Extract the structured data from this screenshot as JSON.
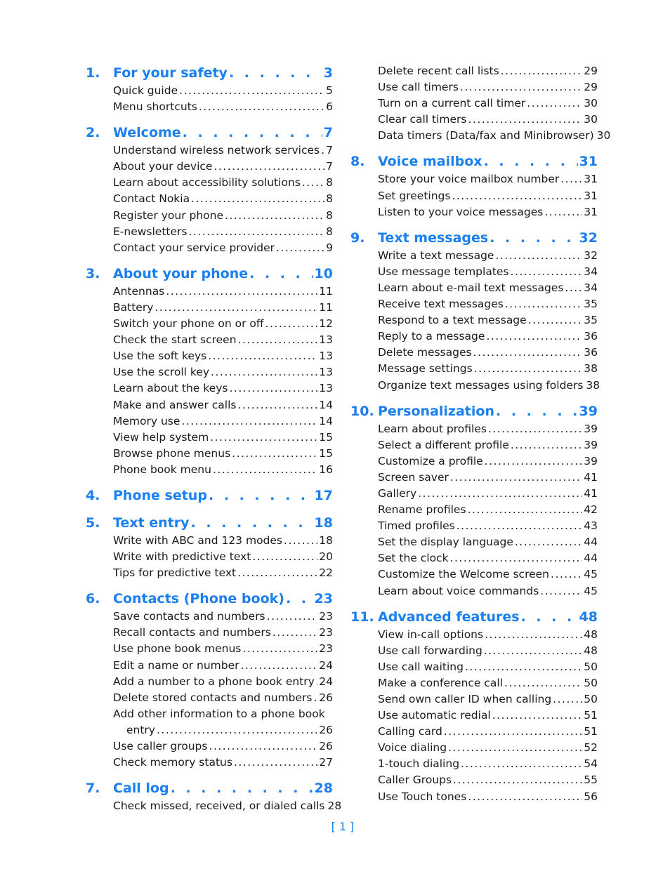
{
  "accent_color": "#1a7ff0",
  "left_column": [
    {
      "num": "1.",
      "title": "For your safety",
      "page": "3",
      "entries": [
        {
          "title": "Quick guide",
          "page": "5"
        },
        {
          "title": "Menu shortcuts",
          "page": "6"
        }
      ]
    },
    {
      "num": "2.",
      "title": "Welcome",
      "page": "7",
      "entries": [
        {
          "title": "Understand wireless network services",
          "page": "7"
        },
        {
          "title": "About your device",
          "page": "7"
        },
        {
          "title": "Learn about accessibility solutions",
          "page": "8"
        },
        {
          "title": "Contact Nokia",
          "page": "8"
        },
        {
          "title": "Register your phone",
          "page": "8"
        },
        {
          "title": "E-newsletters",
          "page": "8"
        },
        {
          "title": "Contact your service provider",
          "page": "9"
        }
      ]
    },
    {
      "num": "3.",
      "title": "About your phone",
      "page": "10",
      "entries": [
        {
          "title": "Antennas",
          "page": "11"
        },
        {
          "title": "Battery",
          "page": "11"
        },
        {
          "title": "Switch your phone on or off",
          "page": "12"
        },
        {
          "title": "Check the start screen",
          "page": "13"
        },
        {
          "title": "Use the soft keys",
          "page": "13"
        },
        {
          "title": "Use the scroll key",
          "page": "13"
        },
        {
          "title": "Learn about the keys",
          "page": "13"
        },
        {
          "title": "Make and answer calls",
          "page": "14"
        },
        {
          "title": "Memory use",
          "page": "14"
        },
        {
          "title": "View help system",
          "page": "15"
        },
        {
          "title": "Browse phone menus",
          "page": "15"
        },
        {
          "title": "Phone book menu",
          "page": "16"
        }
      ]
    },
    {
      "num": "4.",
      "title": "Phone setup",
      "page": "17",
      "entries": []
    },
    {
      "num": "5.",
      "title": "Text entry",
      "page": "18",
      "entries": [
        {
          "title": "Write with ABC and 123 modes",
          "page": "18"
        },
        {
          "title": "Write with predictive text",
          "page": "20"
        },
        {
          "title": "Tips for predictive text",
          "page": "22"
        }
      ]
    },
    {
      "num": "6.",
      "title": "Contacts (Phone book)",
      "page": "23",
      "entries": [
        {
          "title": "Save contacts and numbers",
          "page": "23"
        },
        {
          "title": "Recall contacts and numbers",
          "page": "23"
        },
        {
          "title": "Use phone book menus",
          "page": "23"
        },
        {
          "title": "Edit a name or number",
          "page": "24"
        },
        {
          "title": "Add a number to a phone book entry",
          "page": "24"
        },
        {
          "title": "Delete stored contacts and numbers",
          "page": "26"
        },
        {
          "title": "Add other information to a phone book",
          "continuation": "entry",
          "page": "26"
        },
        {
          "title": "Use caller groups",
          "page": "26"
        },
        {
          "title": "Check memory status",
          "page": "27"
        }
      ]
    },
    {
      "num": "7.",
      "title": "Call log",
      "page": "28",
      "entries": [
        {
          "title": "Check missed, received, or dialed calls",
          "page": "28"
        }
      ]
    }
  ],
  "right_column": [
    {
      "num": "",
      "title": "",
      "page": "",
      "entries": [
        {
          "title": "Delete recent call lists",
          "page": "29"
        },
        {
          "title": "Use call timers",
          "page": "29"
        },
        {
          "title": "Turn on a current call timer",
          "page": "30"
        },
        {
          "title": "Clear call timers",
          "page": "30"
        },
        {
          "title": "Data timers (Data/fax and Minibrowser)",
          "page": "30"
        }
      ]
    },
    {
      "num": "8.",
      "title": "Voice mailbox",
      "page": "31",
      "entries": [
        {
          "title": "Store your voice mailbox number",
          "page": "31"
        },
        {
          "title": "Set greetings",
          "page": "31"
        },
        {
          "title": "Listen to your voice messages",
          "page": "31"
        }
      ]
    },
    {
      "num": "9.",
      "title": "Text messages",
      "page": "32",
      "entries": [
        {
          "title": "Write a text message",
          "page": "32"
        },
        {
          "title": "Use message templates",
          "page": "34"
        },
        {
          "title": "Learn about e-mail text messages",
          "page": "34"
        },
        {
          "title": "Receive text messages",
          "page": "35"
        },
        {
          "title": "Respond to a text message",
          "page": "35"
        },
        {
          "title": "Reply to a message",
          "page": "36"
        },
        {
          "title": "Delete messages",
          "page": "36"
        },
        {
          "title": "Message settings",
          "page": "38"
        },
        {
          "title": "Organize text messages using folders",
          "page": "38"
        }
      ]
    },
    {
      "num": "10.",
      "title": "Personalization",
      "page": "39",
      "entries": [
        {
          "title": "Learn about profiles",
          "page": "39"
        },
        {
          "title": "Select a different profile",
          "page": "39"
        },
        {
          "title": "Customize a profile",
          "page": "39"
        },
        {
          "title": "Screen saver",
          "page": "41"
        },
        {
          "title": "Gallery",
          "page": "41"
        },
        {
          "title": "Rename profiles",
          "page": "42"
        },
        {
          "title": "Timed profiles",
          "page": "43"
        },
        {
          "title": "Set the display language",
          "page": "44"
        },
        {
          "title": "Set the clock",
          "page": "44"
        },
        {
          "title": "Customize the Welcome screen",
          "page": "45"
        },
        {
          "title": "Learn about voice commands",
          "page": "45"
        }
      ]
    },
    {
      "num": "11.",
      "title": "Advanced features",
      "page": "48",
      "entries": [
        {
          "title": "View in-call options",
          "page": "48"
        },
        {
          "title": "Use call forwarding",
          "page": "48"
        },
        {
          "title": "Use call waiting",
          "page": "50"
        },
        {
          "title": "Make a conference call",
          "page": "50"
        },
        {
          "title": "Send own caller ID when calling",
          "page": "50"
        },
        {
          "title": "Use automatic redial",
          "page": "51"
        },
        {
          "title": "Calling card",
          "page": "51"
        },
        {
          "title": "Voice dialing",
          "page": "52"
        },
        {
          "title": "1-touch dialing",
          "page": "54"
        },
        {
          "title": "Caller Groups",
          "page": "55"
        },
        {
          "title": "Use Touch tones",
          "page": "56"
        }
      ]
    }
  ],
  "page_number": "[ 1 ]"
}
